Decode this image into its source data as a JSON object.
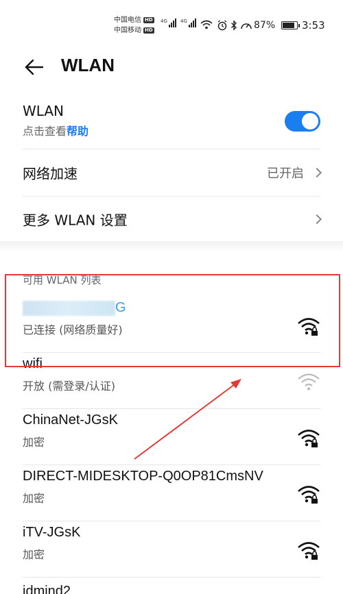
{
  "status_bar": {
    "carrier_1": "中国电信",
    "carrier_2": "中国移动",
    "hd_badge": "HD",
    "signal_1_label": "4G",
    "signal_2_label": "4G",
    "battery_percent": "87%",
    "time": "3:53",
    "icons": [
      "wifi-icon",
      "alarm-icon",
      "bluetooth-icon",
      "speed-icon",
      "battery-icon"
    ]
  },
  "header": {
    "title": "WLAN"
  },
  "wlan_toggle": {
    "label": "WLAN",
    "sub_prefix": "点击查看",
    "help_link": "帮助",
    "on": true
  },
  "network_speedup": {
    "label": "网络加速",
    "value": "已开启"
  },
  "more_settings": {
    "label": "更多 WLAN 设置"
  },
  "available_list": {
    "header": "可用 WLAN 列表",
    "networks": [
      {
        "name_visible_suffix": "G",
        "status": "已连接 (网络质量好)",
        "secured": true,
        "connected": true
      },
      {
        "name": "wifi",
        "status": "开放 (需登录/认证)",
        "secured": false
      },
      {
        "name": "ChinaNet-JGsK",
        "status": "加密",
        "secured": true
      },
      {
        "name": "DIRECT-MIDESKTOP-Q0OP81CmsNV",
        "status": "加密",
        "secured": true
      },
      {
        "name": "iTV-JGsK",
        "status": "加密",
        "secured": true
      },
      {
        "name": "idmind2",
        "status": "",
        "secured": true
      }
    ]
  },
  "colors": {
    "accent": "#1a7ef0",
    "annotation": "#e53935"
  }
}
